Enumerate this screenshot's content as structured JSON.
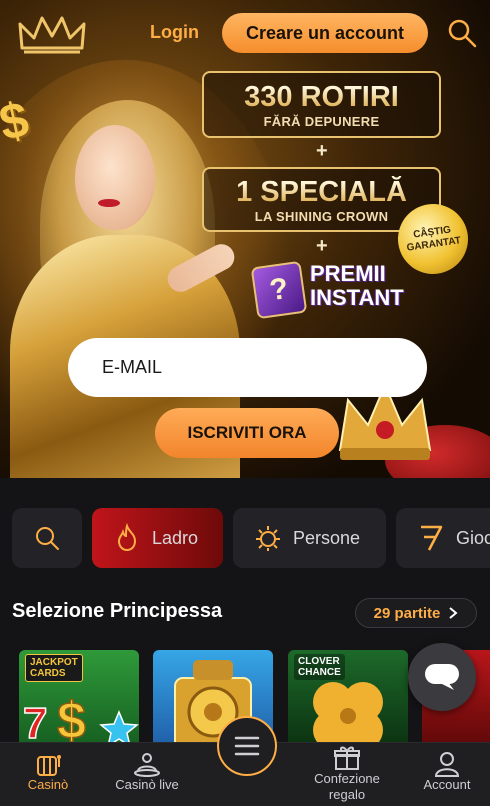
{
  "header": {
    "login_label": "Login",
    "create_account_label": "Creare un account",
    "logo_icon": "crown-logo-icon",
    "search_icon": "search-icon"
  },
  "promo": {
    "line1_big": "330 ROTIRI",
    "line1_small": "FĂRĂ DEPUNERE",
    "plus": "+",
    "line2_big": "1 SPECIALĂ",
    "line2_small": "LA SHINING CROWN",
    "premii_line1": "PREMII",
    "premii_line2": "INSTANT",
    "premii_box": "?",
    "badge_line1": "CÂȘTIG",
    "badge_line2": "GARANTAT"
  },
  "signup": {
    "email_placeholder": "E-MAIL",
    "submit_label": "ISCRIVITI ORA"
  },
  "categories": [
    {
      "label": "",
      "icon": "search-icon",
      "active": false
    },
    {
      "label": "Ladro",
      "icon": "fire-icon",
      "active": true
    },
    {
      "label": "Persone",
      "icon": "sun-badge-icon",
      "active": false
    },
    {
      "label": "Gioc",
      "icon": "seven-icon",
      "active": false
    }
  ],
  "section": {
    "title": "Selezione Principessa",
    "count_label": "29 partite"
  },
  "games": [
    {
      "tag_line1": "JACKPOT",
      "tag_line2": "CARDS",
      "art": "777 dollar"
    },
    {
      "tag_line1": "",
      "tag_line2": "",
      "art": "golden train"
    },
    {
      "tag_line1": "CLOVER",
      "tag_line2": "CHANCE",
      "art": "golden clover"
    },
    {
      "tag_line1": "",
      "tag_line2": "",
      "art": "red"
    }
  ],
  "nav": {
    "casino": "Casinò",
    "live": "Casinò live",
    "gift": "Confezione regalo",
    "account": "Account"
  },
  "colors": {
    "accent": "#ffad45",
    "background": "#141416",
    "chip_active": "#c0151a"
  }
}
